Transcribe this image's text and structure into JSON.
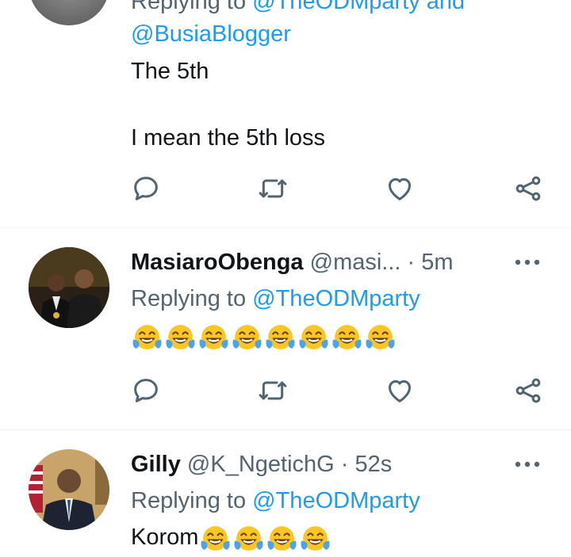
{
  "tweets": [
    {
      "replying_prefix": "Replying to ",
      "replying_handles": "@TheODMparty and",
      "replying_handles_2": "@BusiaBlogger",
      "text_line_1": "The 5th",
      "text_line_2": "I mean the 5th loss"
    },
    {
      "name": "MasiaroObenga",
      "handle": "@masi...",
      "time": "· 5m",
      "replying_prefix": "Replying to ",
      "replying_handle": "@TheODMparty",
      "emoji_count": 8
    },
    {
      "name": "Gilly",
      "handle": "@K_NgetichG",
      "time": "· 52s",
      "replying_prefix": "Replying to ",
      "replying_handle": "@TheODMparty",
      "text": "Korom",
      "emoji_count": 4
    }
  ],
  "icons": {
    "reply": "reply-icon",
    "retweet": "retweet-icon",
    "like": "like-icon",
    "share": "share-icon",
    "more": "more-icon",
    "emoji": "face-with-tears-of-joy-emoji"
  },
  "colors": {
    "link": "#1d9bf0",
    "muted": "#536471",
    "text": "#0f1419"
  }
}
